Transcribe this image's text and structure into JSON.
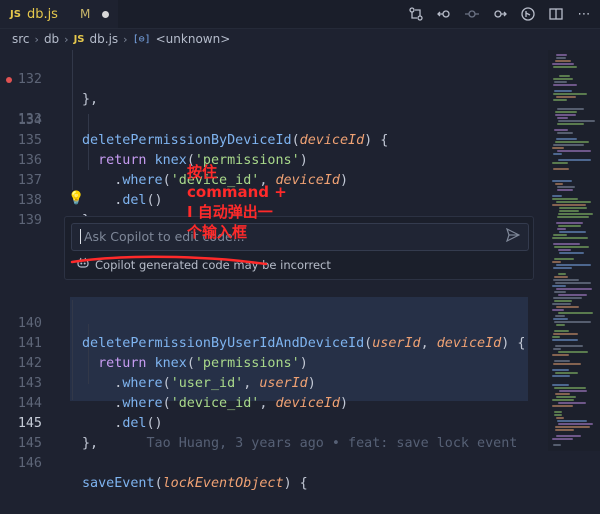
{
  "tab": {
    "badge": "JS",
    "filename": "db.js",
    "modified": "M"
  },
  "breadcrumb": {
    "items": [
      "src",
      "db",
      "db.js"
    ],
    "file_badge": "JS",
    "symbol_icon": "[⊖]",
    "symbol": "<unknown>"
  },
  "editor": {
    "line_numbers": [
      "132",
      "133",
      "134",
      "135",
      "136",
      "137",
      "138",
      "139",
      "140",
      "141",
      "142",
      "143",
      "144",
      "145",
      "146",
      "147"
    ],
    "active_line": "145",
    "code": {
      "l132": "},",
      "l134_fn": "deletePermissionByDeviceId",
      "l134_param": "deviceId",
      "l135_kw": "return",
      "l135_fn": "knex",
      "l135_str": "'permissions'",
      "l136_fn": "where",
      "l136_str": "'device_id'",
      "l136_param": "deviceId",
      "l137_fn": "del",
      "l138": "},",
      "l140_fn": "deletePermissionByUserIdAndDeviceId",
      "l140_param1": "userId",
      "l140_param2": "deviceId",
      "l141_kw": "return",
      "l141_fn": "knex",
      "l141_str": "'permissions'",
      "l142_fn": "where",
      "l142_str": "'user_id'",
      "l142_param": "userId",
      "l143_fn": "where",
      "l143_str": "'device_id'",
      "l143_param": "deviceId",
      "l144_fn": "del",
      "l145": "},",
      "l147_fn": "saveEvent",
      "l147_param": "lockEventObject"
    },
    "blame": "Tao Huang, 3 years ago • feat: save lock event"
  },
  "copilot": {
    "placeholder": "Ask Copilot to edit code...",
    "note": "Copilot generated code may be incorrect"
  },
  "annotation": {
    "line1": "按住",
    "line2": "command +",
    "line3": "I 自动弹出一",
    "line4": "个输入框",
    "color": "#ff2a2a"
  },
  "colors": {
    "background": "#1e2230",
    "function": "#7fb4f0",
    "keyword": "#c79cf2",
    "string": "#a9d98b",
    "parameter": "#f0a274"
  }
}
